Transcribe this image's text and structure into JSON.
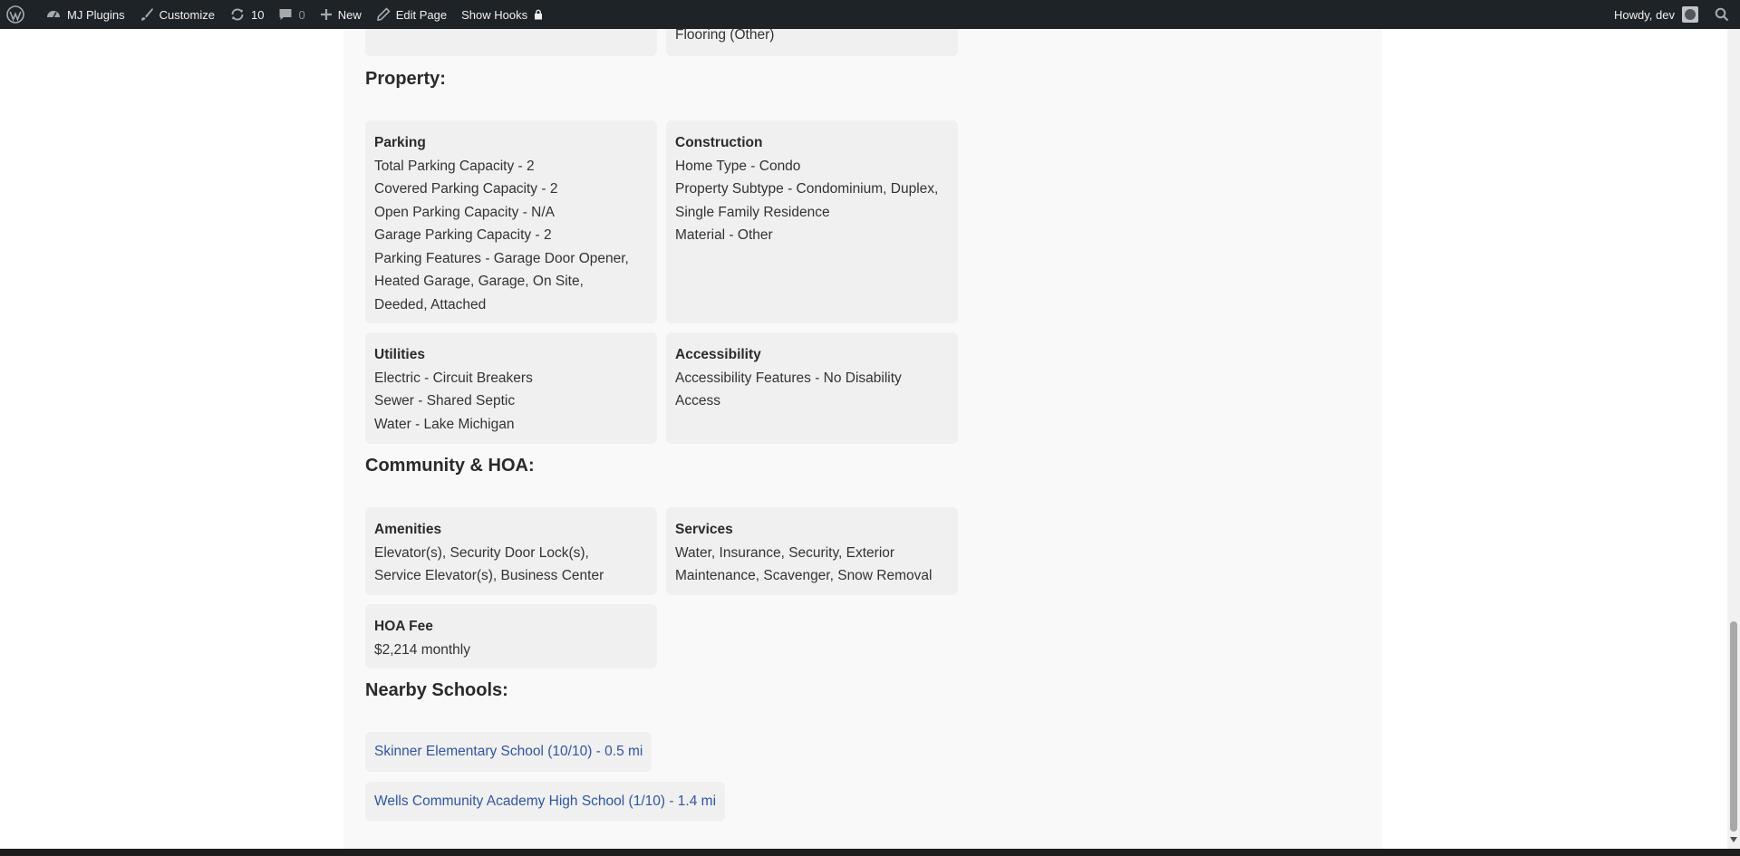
{
  "adminbar": {
    "site_name": "MJ Plugins",
    "customize": "Customize",
    "updates_count": "10",
    "comments_count": "0",
    "new": "New",
    "edit_page": "Edit Page",
    "show_hooks": "Show Hooks",
    "howdy": "Howdy, dev"
  },
  "top_partial": {
    "right_text": "Flooring (Other)"
  },
  "property": {
    "heading": "Property:",
    "parking": {
      "title": "Parking",
      "lines": [
        "Total Parking Capacity - 2",
        "Covered Parking Capacity - 2",
        "Open Parking Capacity - N/A",
        "Garage Parking Capacity - 2",
        "Parking Features - Garage Door Opener,",
        "Heated Garage, Garage, On Site,",
        "Deeded, Attached"
      ]
    },
    "construction": {
      "title": "Construction",
      "lines": [
        "Home Type - Condo",
        "Property Subtype - Condominium, Duplex,",
        "Single Family Residence",
        "Material - Other"
      ]
    },
    "utilities": {
      "title": "Utilities",
      "lines": [
        "Electric - Circuit Breakers",
        "Sewer - Shared Septic",
        "Water - Lake Michigan"
      ]
    },
    "accessibility": {
      "title": "Accessibility",
      "lines": [
        "Accessibility Features - No Disability",
        "Access"
      ]
    }
  },
  "community": {
    "heading": "Community & HOA:",
    "amenities": {
      "title": "Amenities",
      "lines": [
        "Elevator(s), Security Door Lock(s),",
        "Service Elevator(s), Business Center"
      ]
    },
    "services": {
      "title": "Services",
      "lines": [
        "Water, Insurance, Security, Exterior",
        "Maintenance, Scavenger, Snow Removal"
      ]
    },
    "hoa_fee": {
      "title": "HOA Fee",
      "lines": [
        "$2,214 monthly"
      ]
    }
  },
  "schools": {
    "heading": "Nearby Schools:",
    "items": [
      "Skinner Elementary School (10/10) - 0.5 mi",
      "Wells Community Academy High School (1/10) - 1.4 mi"
    ]
  },
  "colors": {
    "adminbar_bg": "#1d2327",
    "card_bg": "#f0f0f0",
    "link": "#2f56a2"
  }
}
